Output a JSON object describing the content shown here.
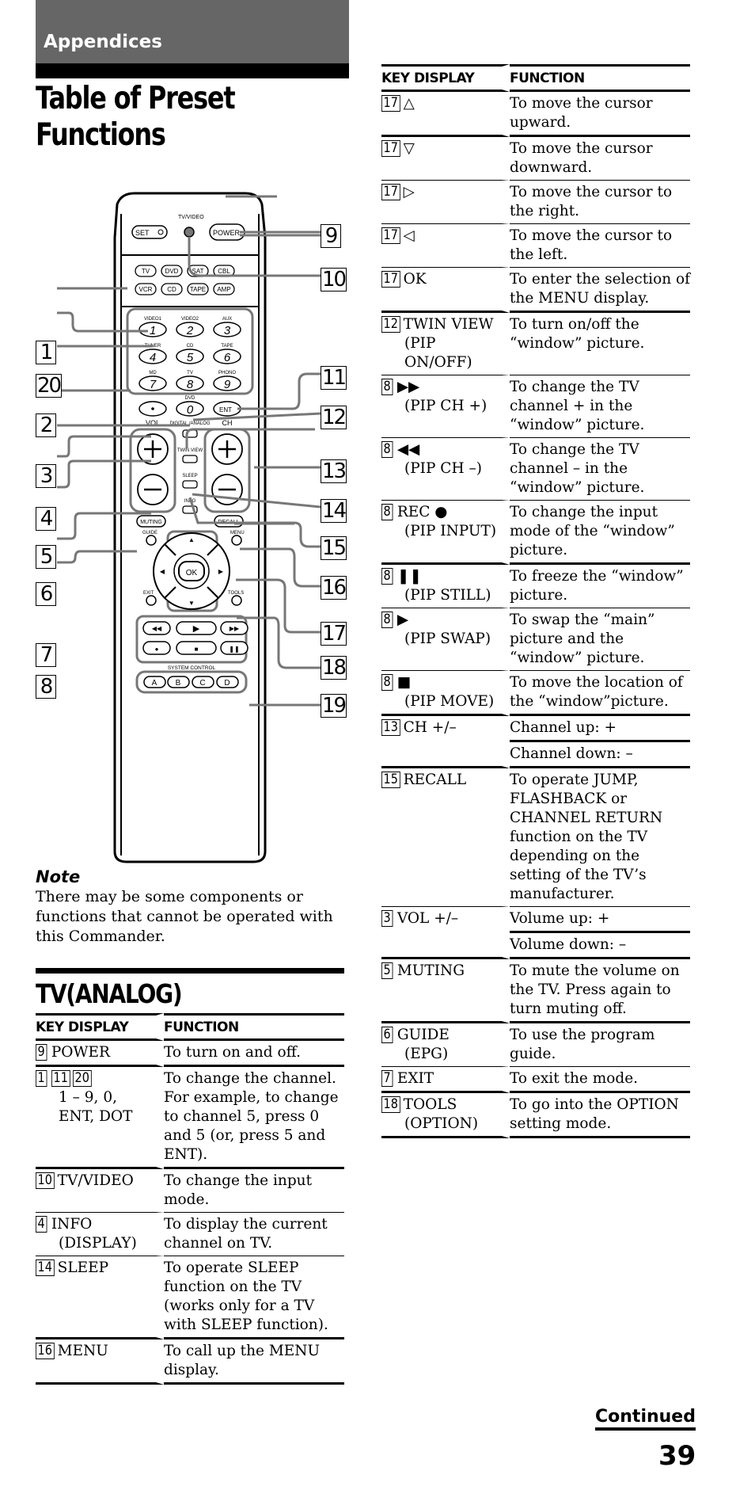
{
  "header": {
    "section": "Appendices",
    "title_line1": "Table of Preset",
    "title_line2": "Functions"
  },
  "remote": {
    "callouts": [
      "1",
      "2",
      "3",
      "4",
      "5",
      "6",
      "7",
      "8",
      "9",
      "10",
      "11",
      "12",
      "13",
      "14",
      "15",
      "16",
      "17",
      "18",
      "19",
      "20"
    ],
    "labels": {
      "tv_video": "TV/VIDEO",
      "set": "SET",
      "power": "POWER",
      "sources": [
        "TV",
        "DVD",
        "SAT",
        "CBL",
        "VCR",
        "CD",
        "TAPE",
        "AMP"
      ],
      "digits": [
        "1",
        "2",
        "3",
        "4",
        "5",
        "6",
        "7",
        "8",
        "9",
        "0"
      ],
      "digit_labels": [
        "VIDEO1",
        "VIDEO2",
        "AUX",
        "TUNER",
        "CD",
        "TAPE",
        "MD",
        "TV",
        "PHONO",
        "DVD"
      ],
      "ent": "ENT",
      "vol": "VOL",
      "ch": "CH",
      "digital_analog": "DIGITAL /ANALOG",
      "twin_view": "TWIN VIEW",
      "sleep": "SLEEP",
      "info": "INFO",
      "muting": "MUTING",
      "recall": "RECALL",
      "guide": "GUIDE",
      "menu": "MENU",
      "ok": "OK",
      "exit": "EXIT",
      "tools": "TOOLS",
      "system_control": "SYSTEM CONTROL",
      "abcd": [
        "A",
        "B",
        "C",
        "D"
      ]
    }
  },
  "note": {
    "title": "Note",
    "body": "There may be some components or functions that cannot be operated with this Commander."
  },
  "tv_analog": {
    "title": "TV(ANALOG)",
    "col_key": "KEY DISPLAY",
    "col_function": "FUNCTION",
    "rows": [
      {
        "nums": [
          "9"
        ],
        "key": "POWER",
        "key2": "",
        "function": "To turn on and off."
      },
      {
        "nums": [
          "1",
          "11",
          "20"
        ],
        "key": "",
        "key2": "1 – 9, 0, ENT, DOT",
        "function": "To change the channel. For example, to change to channel 5, press 0 and 5 (or, press 5 and ENT)."
      },
      {
        "nums": [
          "10"
        ],
        "key": "TV/VIDEO",
        "key2": "",
        "function": "To change the input mode."
      },
      {
        "nums": [
          "4"
        ],
        "key": "INFO",
        "key2": "(DISPLAY)",
        "function": "To display the current channel on TV."
      },
      {
        "nums": [
          "14"
        ],
        "key": "SLEEP",
        "key2": "",
        "function": "To operate SLEEP function on the TV (works only for a TV with SLEEP function)."
      },
      {
        "nums": [
          "16"
        ],
        "key": "MENU",
        "key2": "",
        "function": "To call up the MENU display."
      }
    ]
  },
  "right_table": {
    "col_key": "KEY DISPLAY",
    "col_function": "FUNCTION",
    "rows": [
      {
        "nums": [
          "17"
        ],
        "key": "△",
        "key2": "",
        "function": "To move the cursor upward.",
        "function2": ""
      },
      {
        "nums": [
          "17"
        ],
        "key": "▽",
        "key2": "",
        "function": "To move the cursor downward.",
        "function2": ""
      },
      {
        "nums": [
          "17"
        ],
        "key": "▷",
        "key2": "",
        "function": "To move the cursor to the right.",
        "function2": ""
      },
      {
        "nums": [
          "17"
        ],
        "key": "◁",
        "key2": "",
        "function": "To move the cursor to the left.",
        "function2": ""
      },
      {
        "nums": [
          "17"
        ],
        "key": "OK",
        "key2": "",
        "function": "To enter the selection of the MENU display.",
        "function2": ""
      },
      {
        "nums": [
          "12"
        ],
        "key": "TWIN VIEW",
        "key2": "(PIP ON/OFF)",
        "function": "To turn on/off the “window” picture.",
        "function2": ""
      },
      {
        "nums": [
          "8"
        ],
        "key": "▶▶",
        "key2": "(PIP CH +)",
        "function": "To change the TV channel + in the “window” picture.",
        "function2": ""
      },
      {
        "nums": [
          "8"
        ],
        "key": "◀◀",
        "key2": "(PIP CH –)",
        "function": "To change the TV channel – in the “window” picture.",
        "function2": ""
      },
      {
        "nums": [
          "8"
        ],
        "key": "REC ●",
        "key2": "(PIP INPUT)",
        "function": "To change the input mode of the “window” picture.",
        "function2": ""
      },
      {
        "nums": [
          "8"
        ],
        "key": "❚❚",
        "key2": "(PIP STILL)",
        "function": "To freeze the “window” picture.",
        "function2": ""
      },
      {
        "nums": [
          "8"
        ],
        "key": "▶",
        "key2": "(PIP SWAP)",
        "function": "To swap the “main” picture and the “window” picture.",
        "function2": ""
      },
      {
        "nums": [
          "8"
        ],
        "key": "■",
        "key2": "(PIP MOVE)",
        "function": "To move the location of the “window”picture.",
        "function2": ""
      },
      {
        "nums": [
          "13"
        ],
        "key": "CH +/–",
        "key2": "",
        "function": "Channel up: +",
        "function2": "Channel down: –"
      },
      {
        "nums": [
          "15"
        ],
        "key": "RECALL",
        "key2": "",
        "function": "To operate JUMP, FLASHBACK or CHANNEL RETURN function on the TV depending on the setting of the TV’s manufacturer.",
        "function2": ""
      },
      {
        "nums": [
          "3"
        ],
        "key": "VOL +/–",
        "key2": "",
        "function": "Volume up: +",
        "function2": "Volume down: –"
      },
      {
        "nums": [
          "5"
        ],
        "key": "MUTING",
        "key2": "",
        "function": "To mute the volume on the TV.  Press again to turn muting off.",
        "function2": ""
      },
      {
        "nums": [
          "6"
        ],
        "key": "GUIDE",
        "key2": "(EPG)",
        "function": "To use the program guide.",
        "function2": ""
      },
      {
        "nums": [
          "7"
        ],
        "key": "EXIT",
        "key2": "",
        "function": "To exit the mode.",
        "function2": ""
      },
      {
        "nums": [
          "18"
        ],
        "key": "TOOLS",
        "key2": "(OPTION)",
        "function": "To go into the OPTION setting mode.",
        "function2": ""
      }
    ]
  },
  "footer": {
    "continued": "Continued",
    "page_number": "39"
  }
}
